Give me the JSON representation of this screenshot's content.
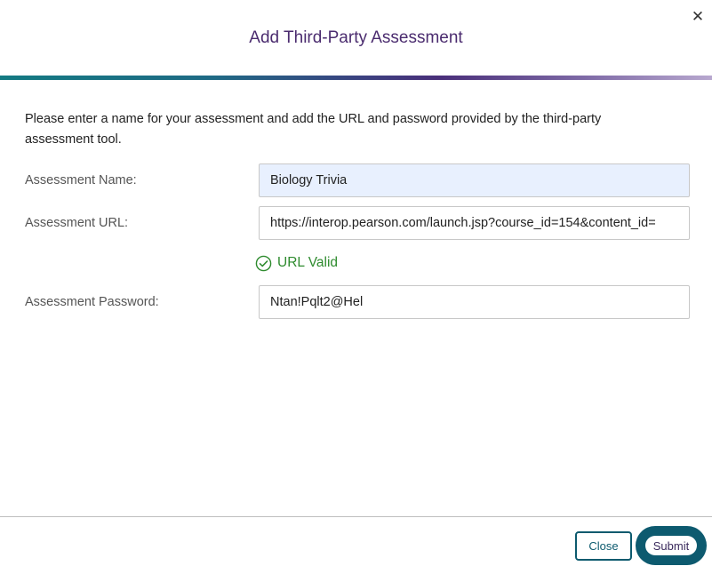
{
  "dialog": {
    "title": "Add Third-Party Assessment",
    "close_icon": "close-icon",
    "close_glyph": "✕"
  },
  "intro_text": "Please enter a name for your assessment and add the URL and password provided by the third-party assessment tool.",
  "fields": {
    "name": {
      "label": "Assessment Name:",
      "value": "Biology Trivia"
    },
    "url": {
      "label": "Assessment URL:",
      "value": "https://interop.pearson.com/launch.jsp?course_id=154&content_id="
    },
    "password": {
      "label": "Assessment Password:",
      "value": "Ntan!Pqlt2@Hel"
    }
  },
  "validation": {
    "icon": "check-circle-icon",
    "text": "URL Valid",
    "color": "#2e8b2e"
  },
  "footer": {
    "close_label": "Close",
    "submit_label": "Submit"
  },
  "colors": {
    "title": "#4b2c6f",
    "accent": "#0c5a6e"
  }
}
